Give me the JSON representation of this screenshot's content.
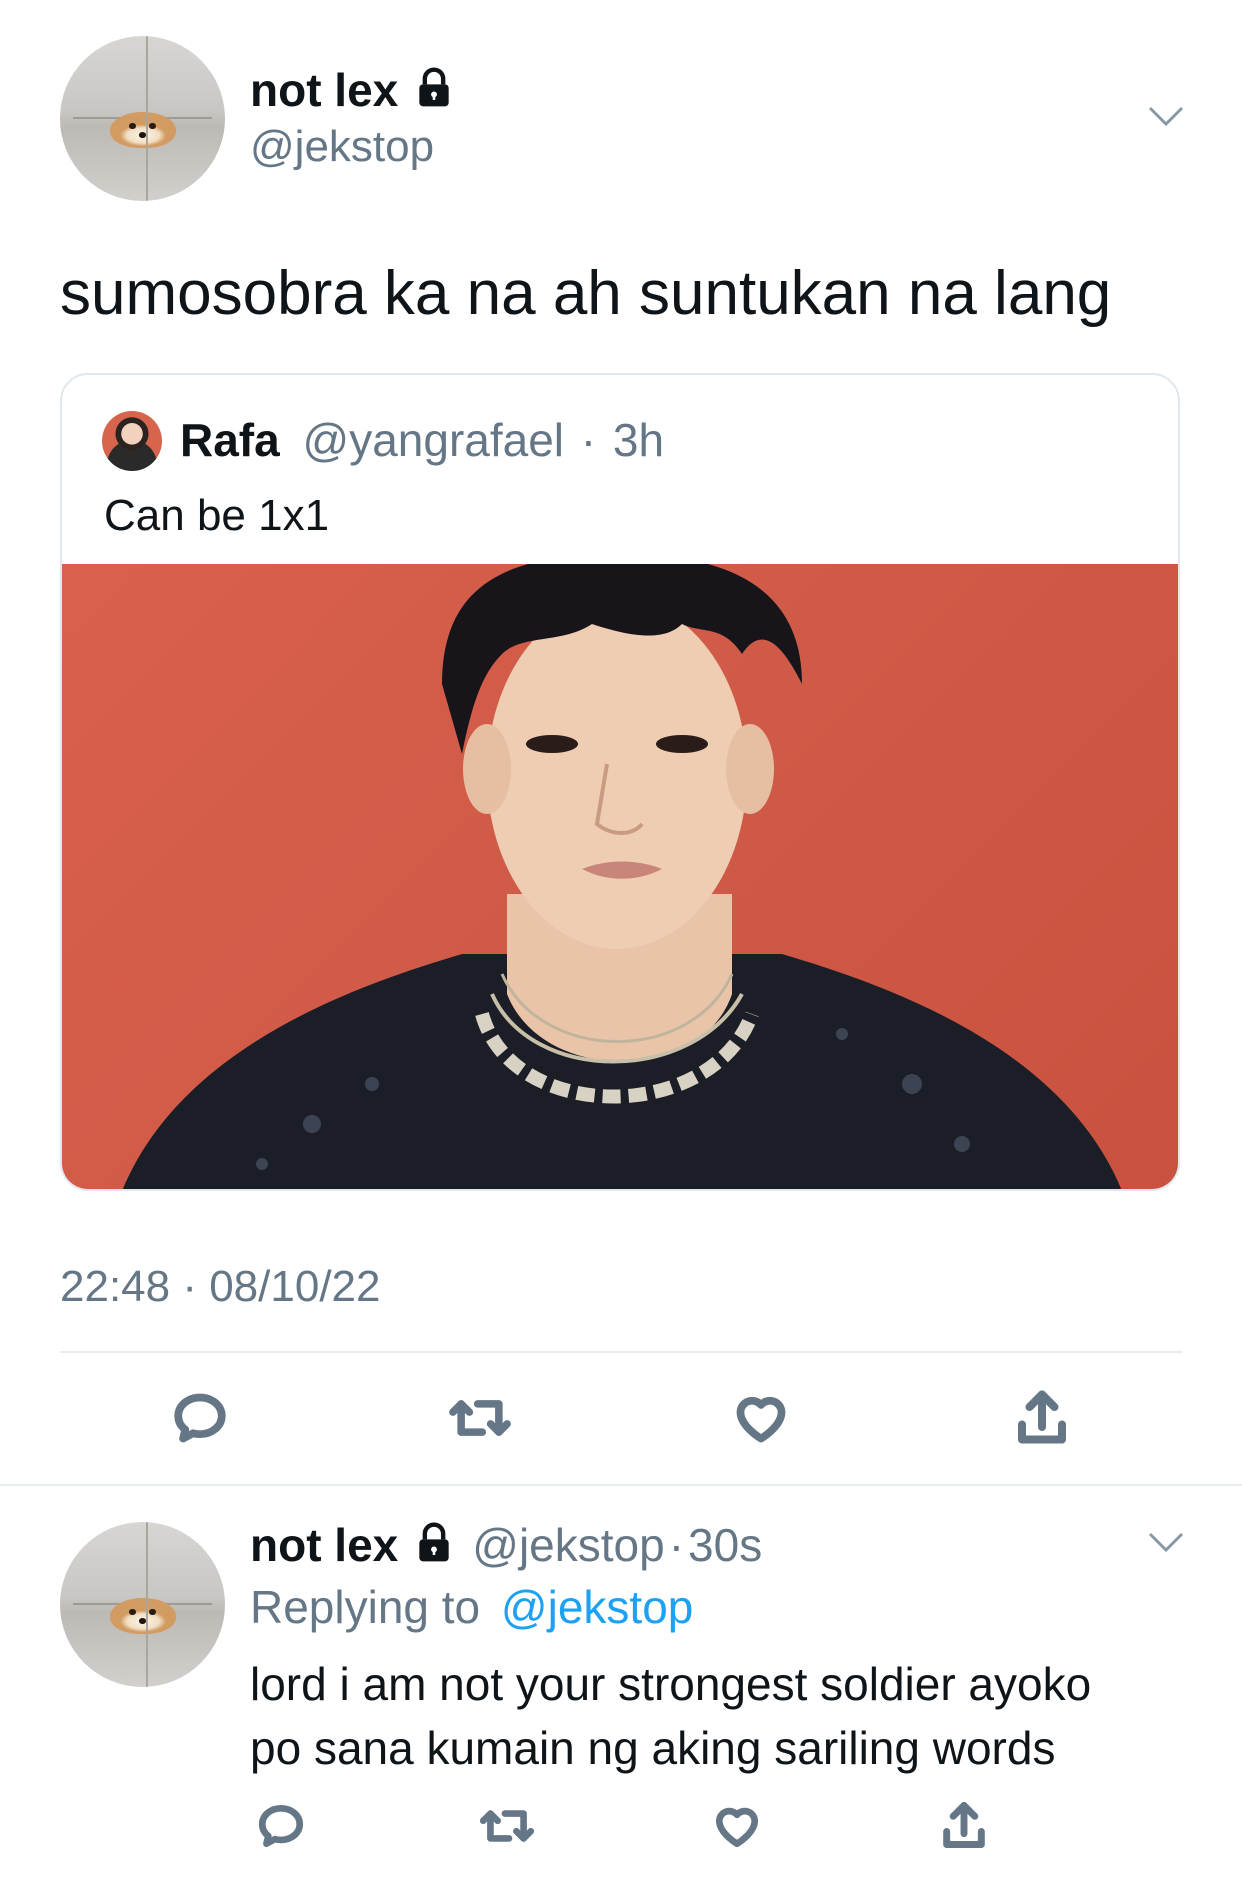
{
  "tweet": {
    "display_name": "not lex",
    "handle": "@jekstop",
    "text": "sumosobra ka na ah suntukan na lang",
    "timestamp": "22:48 · 08/10/22",
    "lock_icon": "lock-icon",
    "menu_icon": "chevron-down-icon"
  },
  "quote": {
    "display_name": "Rafa",
    "handle": "@yangrafael",
    "separator": "·",
    "time": "3h",
    "text": "Can be 1x1",
    "background_color": "#d35c48"
  },
  "actions": [
    "reply-icon",
    "retweet-icon",
    "like-icon",
    "share-icon"
  ],
  "reply": {
    "display_name": "not lex",
    "handle": "@jekstop",
    "separator": "·",
    "time": "30s",
    "replying_label": "Replying to",
    "replying_handle": "@jekstop",
    "text_line1": "lord i am not your strongest soldier ayoko",
    "text_line2": "po sana kumain ng aking sariling words"
  },
  "colors": {
    "link": "#1da1f2",
    "muted": "#657786",
    "divider": "#e6ecf0"
  }
}
